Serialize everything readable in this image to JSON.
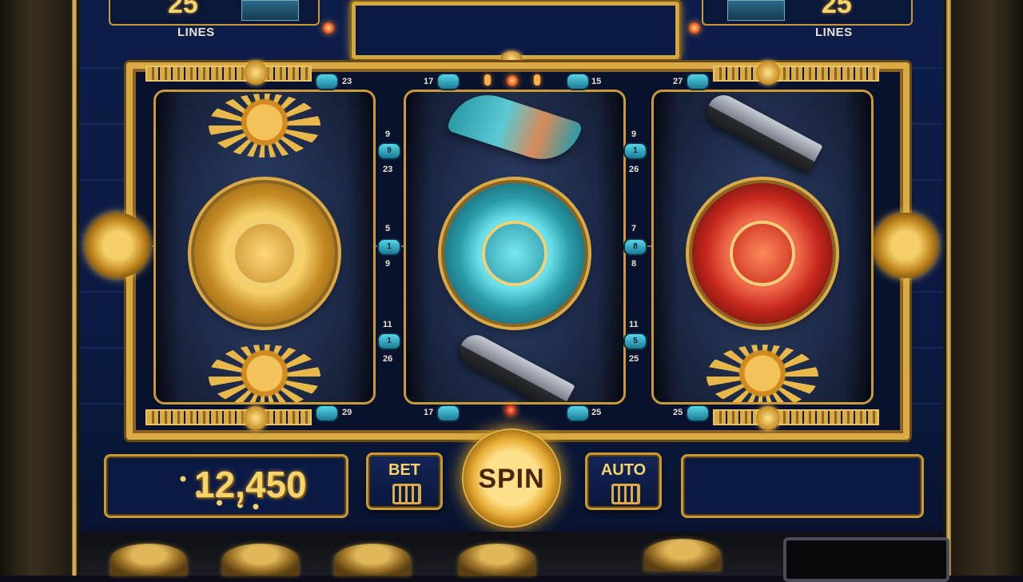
{
  "header": {
    "left_lines_value": "25",
    "left_lines_label": "LINES",
    "right_lines_value": "25",
    "right_lines_label": "LINES",
    "marquee_text": ""
  },
  "reels": [
    {
      "top": "sun",
      "middle": "gold-calendar-disc",
      "bottom": "sun"
    },
    {
      "top": "feathers",
      "middle": "turquoise-calendar-disc",
      "bottom": "obsidian-knife"
    },
    {
      "top": "obsidian-knife",
      "middle": "red-calendar-disc",
      "bottom": "sun"
    }
  ],
  "paylines": {
    "top_markers": [
      "23",
      "17",
      "15",
      "27"
    ],
    "left_gap": {
      "top_a": "9",
      "top_b": "23",
      "mid_a": "5",
      "mid_b": "9",
      "bot_a": "11",
      "bot_b": "26"
    },
    "right_gap": {
      "top_a": "9",
      "top_b": "26",
      "mid_a": "7",
      "mid_b": "8",
      "bot_a": "11",
      "bot_b": "25"
    },
    "bottom_markers": [
      "29",
      "17",
      "25",
      "25"
    ],
    "left_gap_badges": [
      "9",
      "1",
      "1"
    ],
    "right_gap_badges": [
      "1",
      "8",
      "5"
    ]
  },
  "controls": {
    "balance": "12,450",
    "bet_label": "BET",
    "spin_label": "SPIN",
    "auto_label": "AUTO",
    "info_text": ""
  },
  "colors": {
    "gold": "#d9aa45",
    "panel_blue": "#0d1d4a",
    "turquoise": "#3fc3d4",
    "red": "#c8281e"
  }
}
